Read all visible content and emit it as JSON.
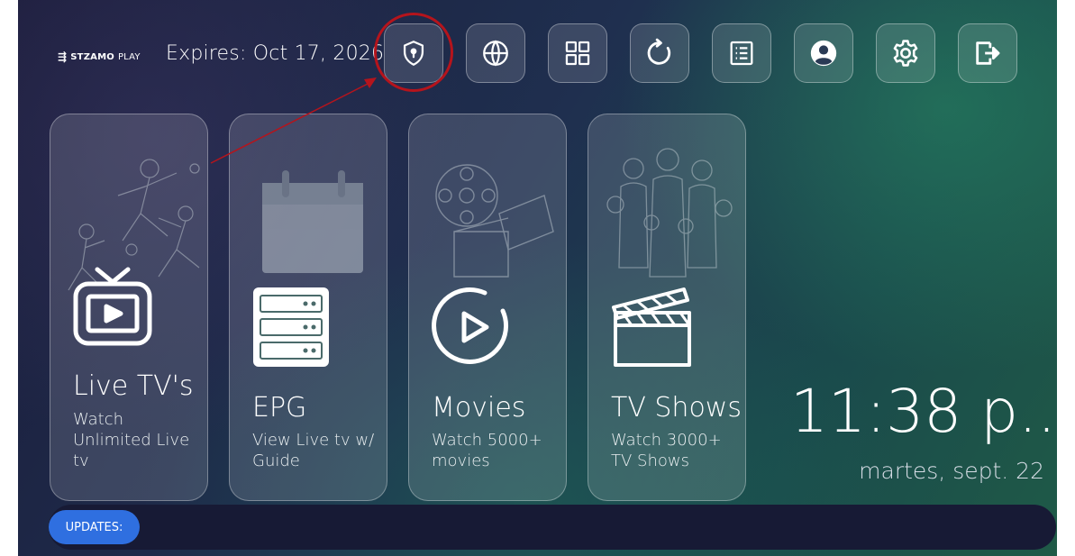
{
  "header": {
    "logo_brand": "STZAMO",
    "logo_suffix": "PLAY",
    "expires": "Expires: Oct 17, 2026"
  },
  "toolbar": {
    "buttons": [
      {
        "name": "vpn-shield",
        "icon": "shield-keyhole-icon",
        "highlighted": true
      },
      {
        "name": "language",
        "icon": "globe-icon"
      },
      {
        "name": "apps-grid",
        "icon": "grid-icon"
      },
      {
        "name": "refresh",
        "icon": "refresh-icon"
      },
      {
        "name": "list",
        "icon": "list-icon"
      },
      {
        "name": "account",
        "icon": "user-icon"
      },
      {
        "name": "settings",
        "icon": "gear-icon"
      },
      {
        "name": "logout",
        "icon": "logout-icon"
      }
    ],
    "highlight_color": "#b5141c"
  },
  "cards": [
    {
      "title": "Live TV's",
      "subtitle": "Watch Unlimited Live tv",
      "icon": "tv-play-icon"
    },
    {
      "title": "EPG",
      "subtitle": "View Live tv w/ Guide",
      "icon": "server-guide-icon"
    },
    {
      "title": "Movies",
      "subtitle": "Watch 5000+ movies",
      "icon": "play-circle-icon"
    },
    {
      "title": "TV Shows",
      "subtitle": "Watch 3000+ TV Shows",
      "icon": "clapperboard-icon"
    }
  ],
  "clock": {
    "time": "11:38 p....",
    "date": "martes, sept. 22"
  },
  "updates": {
    "label": "UPDATES:",
    "color": "#2f6fe0"
  }
}
